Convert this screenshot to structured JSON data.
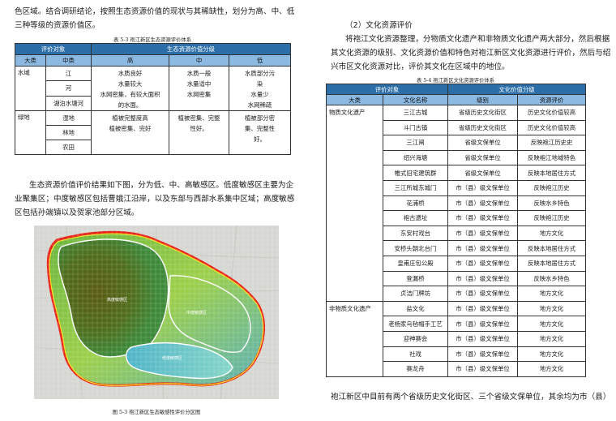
{
  "left": {
    "intro_lines": [
      "色区域。结合调研结论，按照生态资源价值的现状与其稀缺性，划分为高、中、低",
      "三种等级的资源价值区。"
    ],
    "table_title": "表 5-3  袍江新区生态资源评价体系",
    "table": {
      "header_object": "评价对象",
      "header_grade": "生态资源价值分级",
      "sub": [
        "大类",
        "中类",
        "高",
        "中",
        "低"
      ],
      "groups": [
        {
          "major": "水域",
          "minors": [
            "江",
            "河",
            "湖泊水塘河"
          ],
          "high": [
            "水质良好",
            "水量较大",
            "水网密集，有较大面积",
            "的水面。"
          ],
          "mid": [
            "水质一般",
            "水量适中",
            "水网密集"
          ],
          "low": [
            "水质部分污",
            "染",
            "水量少",
            "水网稀疏"
          ]
        },
        {
          "major": "绿地",
          "minors": [
            "湿地",
            "林地",
            "农田"
          ],
          "high": [
            "植被完整度高",
            "植被密集、完好"
          ],
          "mid": [
            "植被密集、完整",
            "性好。"
          ],
          "low": [
            "植被部分密",
            "集、完整性",
            "好。"
          ]
        }
      ]
    },
    "para2_lines": [
      "生态资源价值评价结果如下图，分为低、中、高敏感区。低度敏感区主要为企",
      "业聚集区；中度敏感区包括曹娥江沿岸，以及东部与西部水系集中区域；高度敏感",
      "区包括孙端镇以及贺家池部分区域。"
    ],
    "map_labels": [
      "高度敏感区",
      "中度敏感区",
      "低度敏感区"
    ],
    "figure_caption": "图 5-3  袍江新区生态敏感性评价分区图"
  },
  "right": {
    "section_heading": "（2）文化资源评价",
    "para1_lines": [
      "将袍江文化资源整理，分物质文化遗产和非物质文化遗产两大部分，然后根据",
      "其文化资源的级别、文化资源价值和特色对袍江新区文化资源进行评价，然后与绍",
      "兴市区文化资源对比，评价其文化在区域中的地位。"
    ],
    "table_title": "表 5-4  袍江新区文化资源评价体系",
    "table": {
      "header_object": "评价对象",
      "header_grade": "文化价值分级",
      "sub": [
        "大类",
        "文化名称",
        "级别",
        "资源评价"
      ],
      "groups": [
        {
          "major": "物质文化遗产",
          "rows": [
            [
              "三江古城",
              "省级历史文化街区",
              "历史文化价值较高"
            ],
            [
              "斗门古镇",
              "省级历史文化街区",
              "历史文化价值较高"
            ],
            [
              "三江闸",
              "省级文保单位",
              "反映袍江历史史"
            ],
            [
              "绍兴海塘",
              "省级文保单位",
              "反映袍江地域特色"
            ],
            [
              "帷式旧宅建筑群",
              "省级文保单位",
              "反映本地居住方式"
            ],
            [
              "三江所城东城门",
              "市（县）级文保单位",
              "反映袍江历史"
            ],
            [
              "花浦桥",
              "市（县）级文保单位",
              "反映水乡特色"
            ],
            [
              "袍古遗址",
              "市（县）级文保单位",
              "反映袍江历史"
            ],
            [
              "东安村戏台",
              "市（县）级文保单位",
              "地方文化"
            ],
            [
              "安桥头朝北台门",
              "市（县）级文保单位",
              "反映本地居住方式"
            ],
            [
              "皇甫庄包公殿",
              "市（县）级文保单位",
              "反映本地居住方式"
            ],
            [
              "登漏桥",
              "市（县）级文保单位",
              "反映水乡特色"
            ],
            [
              "贞洁门牌坊",
              "市（县）级文保单位",
              "地方文化"
            ]
          ]
        },
        {
          "major": "非物质文化遗产",
          "rows": [
            [
              "盐文化",
              "市（县）级文保单位",
              "地方文化"
            ],
            [
              "老杨家乌毡帽手工艺",
              "市（县）级文保单位",
              "地方文化"
            ],
            [
              "迎神赛会",
              "市（县）级文保单位",
              "地方文化"
            ],
            [
              "社戏",
              "市（县）级文保单位",
              "地方文化"
            ],
            [
              "赛龙舟",
              "市（县）级文保单位",
              "地方文化"
            ]
          ]
        }
      ]
    },
    "bottom_line": "袍江新区中目前有两个省级历史文化街区、三个省级文保单位，其余均为市（县）"
  }
}
